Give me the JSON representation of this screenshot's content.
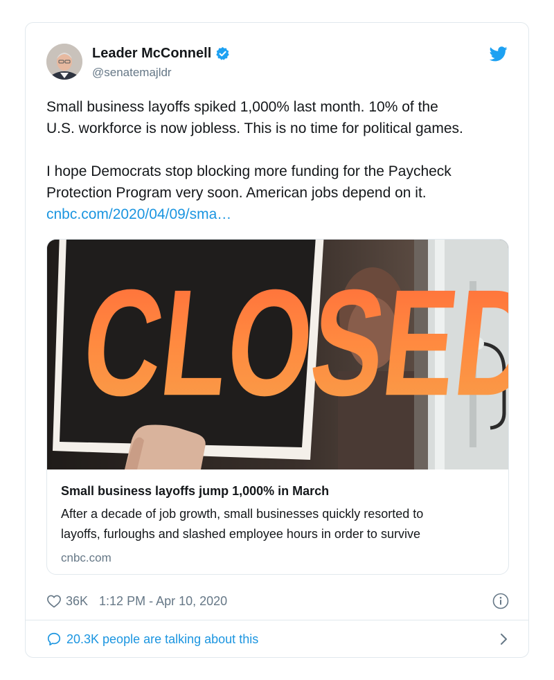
{
  "author": {
    "display_name": "Leader McConnell",
    "handle": "@senatemajldr"
  },
  "tweet": {
    "line1": "Small business layoffs spiked 1,000% last month. 10% of the",
    "line2": "U.S. workforce is now jobless. This is no time for political games.",
    "line3": "I hope Democrats stop blocking more funding for the Paycheck",
    "line4": "Protection Program very soon. American jobs depend on it.",
    "link": "cnbc.com/2020/04/09/sma…"
  },
  "link_card": {
    "sign_text": "CLOSED",
    "title": "Small business layoffs jump 1,000% in March",
    "desc_line1": "After a decade of job growth, small businesses quickly resorted to",
    "desc_line2": "layoffs, furloughs and slashed employee hours in order to survive",
    "domain": "cnbc.com"
  },
  "meta": {
    "likes": "36K",
    "timestamp": "1:12 PM - Apr 10, 2020"
  },
  "footer": {
    "talking": "20.3K people are talking about this"
  },
  "colors": {
    "accent": "#1b95e0",
    "muted": "#657786",
    "border": "#e1e8ed",
    "sign_orange": "#f58a3c"
  },
  "icons": [
    "verified-badge-icon",
    "twitter-bird-icon",
    "heart-icon",
    "info-icon",
    "speech-bubble-icon",
    "chevron-right-icon"
  ]
}
